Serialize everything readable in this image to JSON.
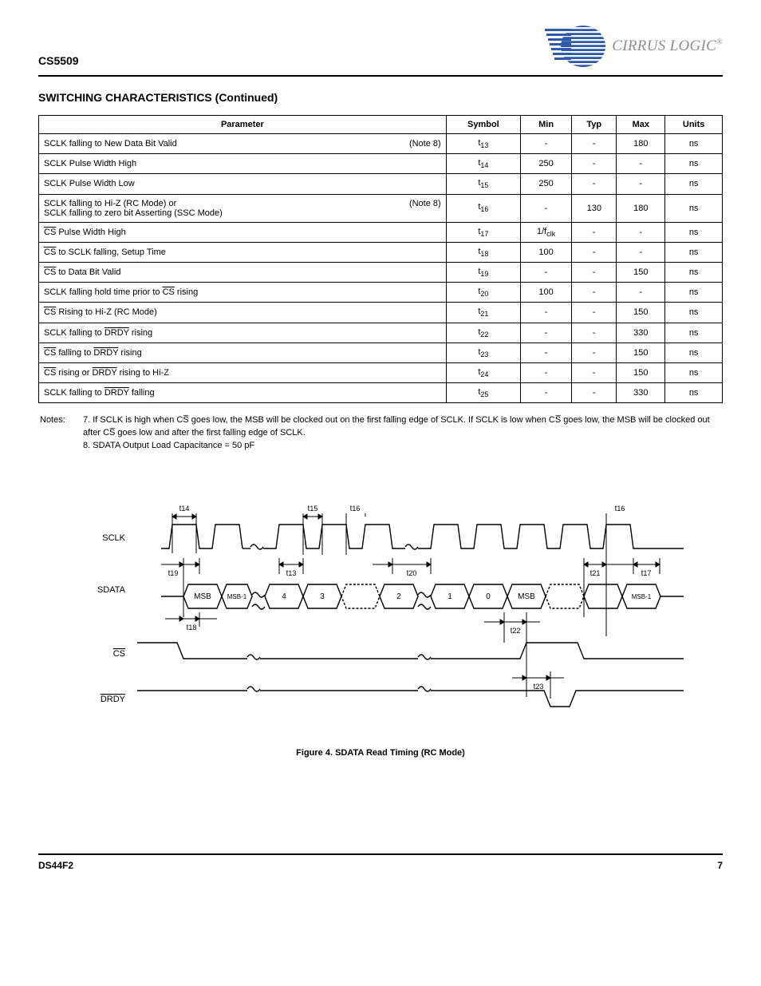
{
  "header": {
    "part_number": "CS5509",
    "brand": "CIRRUS LOGIC"
  },
  "section_title": "SWITCHING CHARACTERISTICS (Continued)",
  "table": {
    "headers": [
      "Parameter",
      "Symbol",
      "Min",
      "Typ",
      "Max",
      "Units"
    ],
    "rows": [
      {
        "param": "SCLK falling to New Data Bit Valid",
        "note": "(Note 8)",
        "sym": "t13",
        "min": "-",
        "typ": "-",
        "max": "180",
        "units": "ns"
      },
      {
        "param": "SCLK Pulse Width High",
        "sym": "t14",
        "min": "250",
        "typ": "-",
        "max": "-",
        "units": "ns"
      },
      {
        "param": "SCLK Pulse Width Low",
        "sym": "t15",
        "min": "250",
        "typ": "-",
        "max": "-",
        "units": "ns"
      },
      {
        "param": "SCLK falling to Hi-Z (RC Mode) or\nSCLK falling to zero bit Asserting (SSC Mode)",
        "note": "(Note 8)",
        "sym": "t16",
        "min": "-",
        "typ": "130",
        "max": "180",
        "units": "ns"
      },
      {
        "param": "CS̅ Pulse Width High",
        "sym": "t17",
        "min": "1/fclk",
        "typ": "-",
        "max": "-",
        "units": "ns"
      },
      {
        "param": "CS̅ to SCLK falling, Setup Time",
        "sym": "t18",
        "min": "100",
        "typ": "-",
        "max": "-",
        "units": "ns"
      },
      {
        "param": "CS̅ to Data Bit Valid",
        "sym": "t19",
        "min": "-",
        "typ": "-",
        "max": "150",
        "units": "ns"
      },
      {
        "param": "SCLK falling hold time prior to CS̅ rising",
        "sym": "t20",
        "min": "100",
        "typ": "-",
        "max": "-",
        "units": "ns"
      },
      {
        "param": "CS̅ Rising to Hi-Z (RC Mode)",
        "sym": "t21",
        "min": "-",
        "typ": "-",
        "max": "150",
        "units": "ns"
      },
      {
        "param": "SCLK falling to DRDY̅ rising",
        "sym": "t22",
        "min": "-",
        "typ": "-",
        "max": "330",
        "units": "ns"
      },
      {
        "param": "CS̅ falling to DRDY̅ rising",
        "sym": "t23",
        "min": "-",
        "typ": "-",
        "max": "150",
        "units": "ns"
      },
      {
        "param": "CS̅ rising or DRDY̅ rising to Hi-Z",
        "sym": "t24",
        "min": "-",
        "typ": "-",
        "max": "150",
        "units": "ns"
      },
      {
        "param": "SCLK falling to DRDY̅ falling",
        "sym": "t25",
        "min": "-",
        "typ": "-",
        "max": "330",
        "units": "ns"
      }
    ]
  },
  "notes": {
    "label": "Notes:",
    "items": [
      {
        "n": "7.",
        "text": "If SCLK is high when CS̅ goes low, the MSB will be clocked out on the first falling edge of SCLK. If SCLK is low when CS̅ goes low, the MSB will be clocked out after CS̅ goes low and after the first falling edge of SCLK."
      },
      {
        "n": "8.",
        "text": "SDATA Output Load Capacitance = 50 pF"
      }
    ]
  },
  "diagram": {
    "signals": [
      "SCLK",
      "SDATA",
      "CS",
      "DRDY"
    ],
    "sclk_over": false,
    "cs_over": true,
    "drdy_over": true,
    "timing_marks_top": [
      "t14",
      "t15",
      "t16",
      "t16"
    ],
    "timing_marks_mid": [
      "t19",
      "t13",
      "t20",
      "t21",
      "t17"
    ],
    "timing_marks_low": [
      "t18",
      "t22",
      "t23"
    ],
    "sdata_bits": [
      "MSB",
      "MSB-1",
      "4",
      "3",
      "2",
      "1",
      "0",
      "MSB",
      "MSB-1"
    ],
    "caption": "Figure 4. SDATA Read Timing (RC Mode)"
  },
  "footer": {
    "left": "DS44F2",
    "right": "7"
  }
}
